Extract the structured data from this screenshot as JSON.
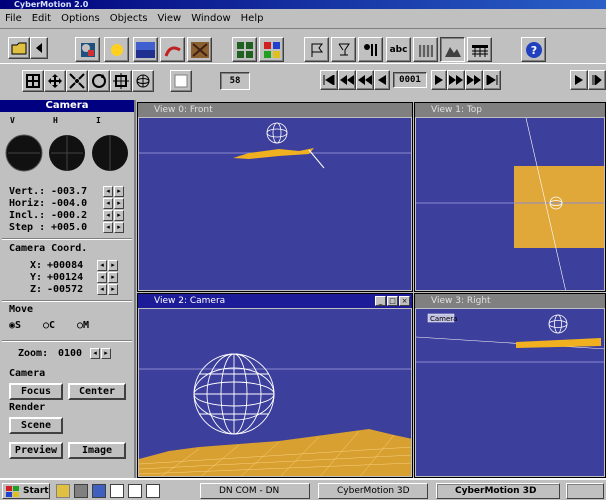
{
  "app": {
    "title": "CyberMotion 2.0"
  },
  "menu": [
    "File",
    "Edit",
    "Options",
    "Objects",
    "View",
    "Window",
    "Help"
  ],
  "toolbar2": {
    "frame_label": "58",
    "counter": "0001",
    "abc": "abc"
  },
  "camera_panel": {
    "title": "Camera",
    "dials": [
      "V",
      "H",
      "I"
    ],
    "rows": [
      {
        "label": "Vert.:",
        "value": "-003.7"
      },
      {
        "label": "Horiz:",
        "value": "-004.0"
      },
      {
        "label": "Incl.:",
        "value": "-000.2"
      },
      {
        "label": "Step :",
        "value": "+005.0"
      }
    ],
    "coord_title": "Camera Coord.",
    "coords": [
      {
        "label": "X:",
        "value": "+00084"
      },
      {
        "label": "Y:",
        "value": "+00124"
      },
      {
        "label": "Z:",
        "value": "-00572"
      }
    ],
    "move_title": "Move",
    "move_options": [
      "S",
      "C",
      "M"
    ],
    "zoom_label": "Zoom:",
    "zoom_value": "0100",
    "camera_section": "Camera",
    "focus_label": "Focus",
    "center_label": "Center",
    "render_section": "Render",
    "scene_label": "Scene",
    "preview_label": "Preview",
    "image_label": "Image"
  },
  "views": [
    {
      "title": "View 0:   Front"
    },
    {
      "title": "View 1:   Top"
    },
    {
      "title": "View 2:   Camera"
    },
    {
      "title": "View 3:   Right"
    }
  ],
  "view3_label": "Camera",
  "taskbar": {
    "start": "Start",
    "items": [
      "DN COM - DN",
      "CyberMotion 3D",
      "CyberMotion 3D"
    ]
  }
}
